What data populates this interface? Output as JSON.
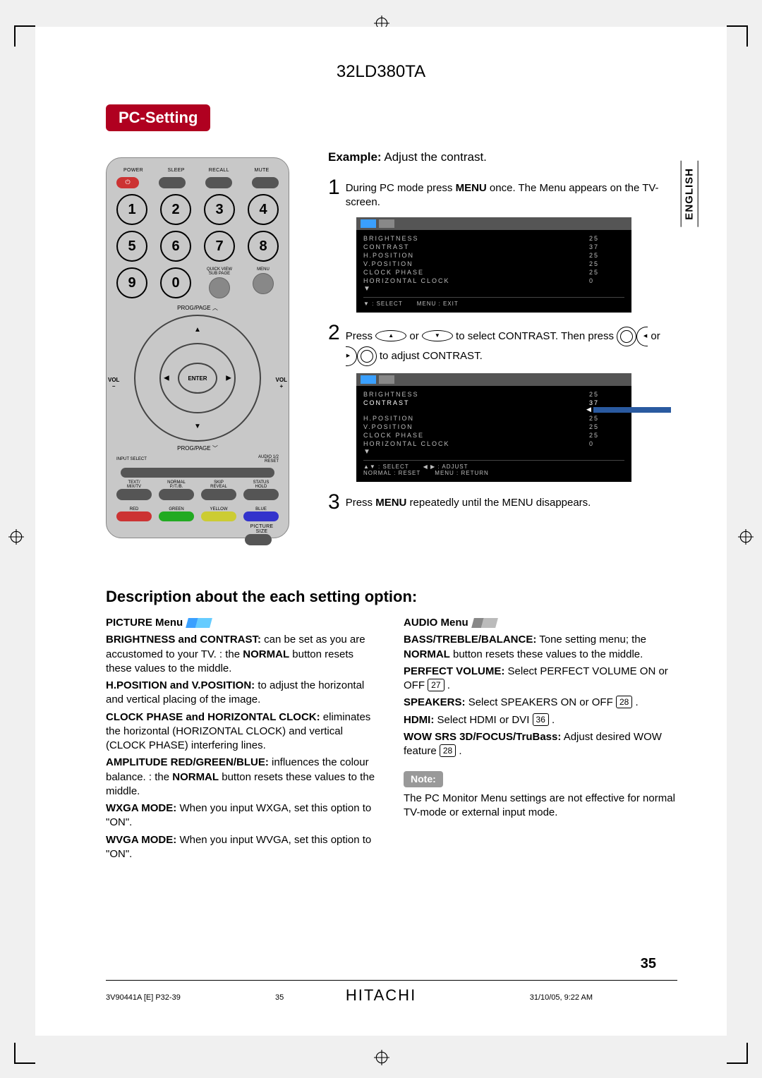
{
  "model": "32LD380TA",
  "heading": "PC-Setting",
  "language_tab": "ENGLISH",
  "example_label": "Example:",
  "example_text": " Adjust the contrast.",
  "steps": {
    "s1": {
      "num": "1",
      "text_a": "During PC mode press ",
      "menu": "MENU",
      "text_b": " once. The Menu appears on the TV-screen."
    },
    "s2": {
      "num": "2",
      "text_a": "Press ",
      "text_b": " or ",
      "text_c": " to select CONTRAST. Then press ",
      "text_d": " or ",
      "text_e": " to adjust CONTRAST."
    },
    "s3": {
      "num": "3",
      "text_a": "Press ",
      "menu": "MENU",
      "text_b": " repeatedly until the MENU disappears."
    }
  },
  "osd1": {
    "rows": [
      {
        "label": "BRIGHTNESS",
        "val": "25"
      },
      {
        "label": "CONTRAST",
        "val": "37"
      },
      {
        "label": "H.POSITION",
        "val": "25"
      },
      {
        "label": "V.POSITION",
        "val": "25"
      },
      {
        "label": "CLOCK PHASE",
        "val": "25"
      },
      {
        "label": "HORIZONTAL CLOCK",
        "val": "0"
      }
    ],
    "foot_select": "▼ : SELECT",
    "foot_exit": "MENU : EXIT"
  },
  "osd2": {
    "rows": [
      {
        "label": "BRIGHTNESS",
        "val": "25"
      },
      {
        "label": "CONTRAST",
        "val": "37"
      },
      {
        "label": "H.POSITION",
        "val": "25"
      },
      {
        "label": "V.POSITION",
        "val": "25"
      },
      {
        "label": "CLOCK PHASE",
        "val": "25"
      },
      {
        "label": "HORIZONTAL CLOCK",
        "val": "0"
      }
    ],
    "foot_select": "▲▼ : SELECT",
    "foot_adjust": "◀ ▶ : ADJUST",
    "foot_normal": "NORMAL : RESET",
    "foot_return": "MENU : RETURN"
  },
  "remote": {
    "top": [
      "POWER",
      "SLEEP",
      "RECALL",
      "MUTE"
    ],
    "nums": [
      "1",
      "2",
      "3",
      "4",
      "5",
      "6",
      "7",
      "8",
      "9",
      "0"
    ],
    "quickview": "QUICK VIEW\nSUB PAGE",
    "menu": "MENU",
    "progpage_up": "PROG/PAGE ︿",
    "progpage_down": "PROG/PAGE ﹀",
    "vol": "VOL",
    "minus": "–",
    "plus": "+",
    "enter": "ENTER",
    "input_select": "INPUT SELECT",
    "audio12": "AUDIO 1/2\nRESET",
    "mid": [
      "TEXT/\nMIX/TV",
      "NORMAL\nP./T./B.",
      "SKIP\nREVEAL",
      "STATUS\nHOLD"
    ],
    "colors": [
      "RED",
      "GREEN",
      "YELLOW",
      "BLUE"
    ],
    "picture_size": "PICTURE\nSIZE"
  },
  "desc_heading": "Description about the each setting option:",
  "picture_menu": {
    "title": "PICTURE Menu",
    "p1a": "BRIGHTNESS and CONTRAST:",
    "p1b": " can be set as you are accustomed to your TV. : the ",
    "p1c": "NORMAL",
    "p1d": " button resets these values to the middle.",
    "p2a": "H.POSITION and V.POSITION:",
    "p2b": " to adjust the horizontal and vertical placing of the image.",
    "p3a": "CLOCK PHASE and HORIZONTAL CLOCK:",
    "p3b": " eliminates the horizontal (HORIZONTAL CLOCK) and vertical (CLOCK PHASE) interfering lines.",
    "p4a": "AMPLITUDE RED/GREEN/BLUE:",
    "p4b": " influences the colour balance. : the ",
    "p4c": "NORMAL",
    "p4d": " button resets these values to the middle.",
    "p5a": "WXGA MODE:",
    "p5b": " When you input WXGA, set this option to \"ON\".",
    "p6a": "WVGA MODE:",
    "p6b": " When you input WVGA, set this option to \"ON\"."
  },
  "audio_menu": {
    "title": "AUDIO Menu",
    "p1a": "BASS/TREBLE/BALANCE:",
    "p1b": " Tone setting menu; the ",
    "p1c": "NORMAL",
    "p1d": " button resets these values to the middle.",
    "p2a": "PERFECT VOLUME:",
    "p2b": " Select PERFECT VOLUME ON or OFF ",
    "p2ref": "27",
    "p3a": "SPEAKERS:",
    "p3b": " Select SPEAKERS ON or OFF ",
    "p3ref": "28",
    "p4a": "HDMI:",
    "p4b": " Select HDMI or DVI ",
    "p4ref": "36",
    "p5a": "WOW SRS 3D/FOCUS/TruBass:",
    "p5b": " Adjust desired WOW feature ",
    "p5ref": "28"
  },
  "note_label": "Note:",
  "note_text": "The PC Monitor Menu settings are not effective for normal TV-mode or external input mode.",
  "page_number": "35",
  "brand": "HITACHI",
  "footer": {
    "left": "3V90441A [E] P32-39",
    "mid": "35",
    "right": "31/10/05, 9:22 AM"
  }
}
